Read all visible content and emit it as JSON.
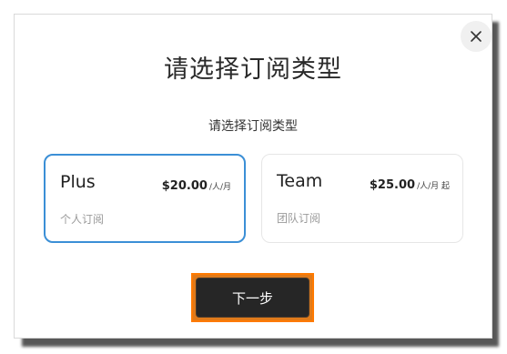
{
  "dialog": {
    "title": "请选择订阅类型",
    "subtitle": "请选择订阅类型",
    "close_icon": "close-icon"
  },
  "plans": [
    {
      "name": "Plus",
      "price": "$20.00",
      "unit": "/人/月",
      "description": "个人订阅",
      "selected": true
    },
    {
      "name": "Team",
      "price": "$25.00",
      "unit": "/人/月 起",
      "description": "团队订阅",
      "selected": false
    }
  ],
  "actions": {
    "next_label": "下一步"
  },
  "colors": {
    "selected_border": "#3b8fd6",
    "button_bg": "#262626",
    "highlight_outline": "#ff7a00"
  }
}
